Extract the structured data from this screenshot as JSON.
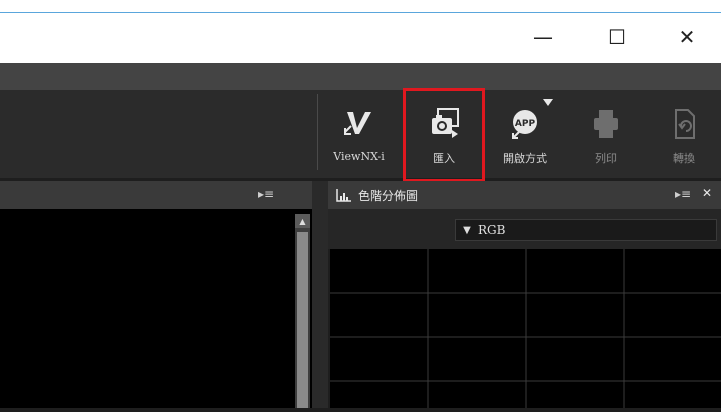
{
  "window": {
    "minimize_glyph": "—",
    "maximize_glyph": "☐",
    "close_glyph": "✕"
  },
  "toolbar": {
    "items": [
      {
        "label": "ViewNX-i",
        "icon": "viewnx-icon",
        "enabled": true
      },
      {
        "label": "匯入",
        "icon": "import-icon",
        "enabled": true,
        "highlighted": true
      },
      {
        "label": "開啟方式",
        "icon": "open-with-app-icon",
        "enabled": true,
        "has_dropdown": true
      },
      {
        "label": "列印",
        "icon": "print-icon",
        "enabled": false
      },
      {
        "label": "轉換",
        "icon": "convert-icon",
        "enabled": false
      }
    ]
  },
  "panels": {
    "left": {
      "menu_glyph": "▸≡"
    },
    "histogram": {
      "title": "色階分佈圖",
      "menu_glyph": "▸≡",
      "close_glyph": "✕",
      "channel": "RGB"
    }
  },
  "colors": {
    "accent_highlight": "#e0181f",
    "toolbar_bg": "#2b2b2b",
    "panel_bg": "#000000"
  }
}
